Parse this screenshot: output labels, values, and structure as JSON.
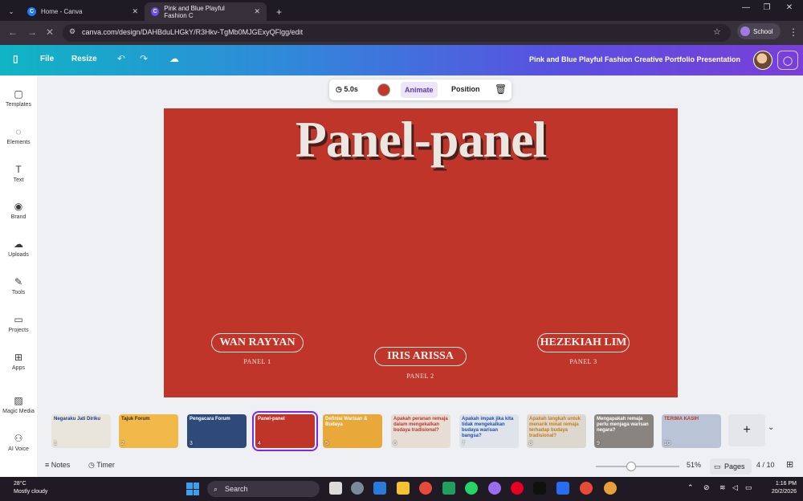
{
  "browser": {
    "tabs": [
      {
        "title": "Home - Canva",
        "favicon_color": "#1f7af0"
      },
      {
        "title": "Pink and Blue Playful Fashion C",
        "favicon_color": "#6c4cf0"
      }
    ],
    "new_tab": "+",
    "url": "canva.com/design/DAHBduLHGkY/R3Hkv-TgMb0MJGExyQFlgg/edit",
    "profile_label": "School"
  },
  "canva_header": {
    "file_label": "File",
    "resize_label": "Resize",
    "document_title": "Pink and Blue Playful Fashion Creative Portfolio Presentation"
  },
  "sidebar": {
    "items": [
      {
        "label": "Templates",
        "icon": "templates-icon"
      },
      {
        "label": "Elements",
        "icon": "elements-icon"
      },
      {
        "label": "Text",
        "icon": "text-icon"
      },
      {
        "label": "Brand",
        "icon": "brand-icon"
      },
      {
        "label": "Uploads",
        "icon": "uploads-icon"
      },
      {
        "label": "Tools",
        "icon": "tools-icon"
      },
      {
        "label": "Projects",
        "icon": "projects-icon"
      },
      {
        "label": "Apps",
        "icon": "apps-icon"
      },
      {
        "label": "Magic Media",
        "icon": "magic-media-icon"
      },
      {
        "label": "AI Voice",
        "icon": "ai-voice-icon"
      }
    ]
  },
  "floating_toolbar": {
    "duration": "5.0s",
    "color": "#c0392b",
    "animate_label": "Animate",
    "position_label": "Position"
  },
  "slide": {
    "background": "#c0352a",
    "title": "Panel-panel",
    "panels": [
      {
        "name": "WAN RAYYAN",
        "sub": "PANEL 1"
      },
      {
        "name": "IRIS ARISSA",
        "sub": "PANEL 2"
      },
      {
        "name": "HEZEKIAH LIM",
        "sub": "PANEL 3"
      }
    ]
  },
  "thumbnails": [
    {
      "num": "1",
      "text": "Negaraku Jati Diriku",
      "bg": "#e9e4dc",
      "fg": "#1d3a8a"
    },
    {
      "num": "2",
      "text": "Tajuk Forum",
      "bg": "#f1b84a",
      "fg": "#3a2a10"
    },
    {
      "num": "3",
      "text": "Pengacara Forum",
      "bg": "#2d4a7a",
      "fg": "#ffffff"
    },
    {
      "num": "4",
      "text": "Panel-panel",
      "bg": "#c0352a",
      "fg": "#ffffff"
    },
    {
      "num": "5",
      "text": "Definisi Warisan & Budaya",
      "bg": "#e9a83a",
      "fg": "#ffffff"
    },
    {
      "num": "6",
      "text": "Apakah peranan remaja dalam mengekalkan budaya tradisional?",
      "bg": "#e6ddd4",
      "fg": "#c0352a"
    },
    {
      "num": "7",
      "text": "Apakah impak jika kita tidak mengekalkan budaya warisan bangsa?",
      "bg": "#dfe3ea",
      "fg": "#1d4fa8"
    },
    {
      "num": "8",
      "text": "Apakah langkah untuk menarik minat remaja terhadap budaya tradisional?",
      "bg": "#ddd8cf",
      "fg": "#c77a10"
    },
    {
      "num": "9",
      "text": "Mengapakah remaja perlu menjaga warisan negara?",
      "bg": "#8a8480",
      "fg": "#ffffff"
    },
    {
      "num": "10",
      "text": "TERIMA KASIH",
      "bg": "#b9c4d6",
      "fg": "#c0352a"
    }
  ],
  "bottom_bar": {
    "notes_label": "Notes",
    "timer_label": "Timer",
    "zoom": "51%",
    "pages_label": "Pages",
    "page_counter": "4 / 10"
  },
  "taskbar": {
    "weather_temp": "28°C",
    "weather_desc": "Mostly cloudy",
    "search_label": "Search",
    "time": "1:16 PM",
    "date": "20/2/2026"
  }
}
